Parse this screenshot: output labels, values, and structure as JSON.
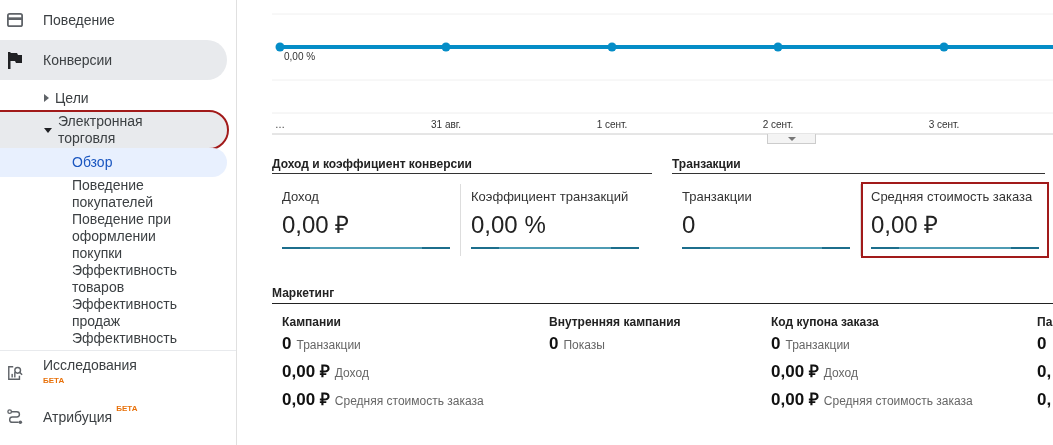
{
  "sidebar": {
    "items": [
      {
        "label": "Поведение",
        "selected": false
      },
      {
        "label": "Конверсии",
        "selected": true
      }
    ],
    "tree": [
      {
        "label": "Цели",
        "expanded": false,
        "highlighted": false
      },
      {
        "label": "Электронная торговля",
        "expanded": true,
        "highlighted": true,
        "children": [
          {
            "label": "Обзор",
            "selected": true
          },
          {
            "label": "Поведение покупателей",
            "selected": false
          },
          {
            "label": "Поведение при оформлении покупки",
            "selected": false
          },
          {
            "label": "Эффективность товаров",
            "selected": false
          },
          {
            "label": "Эффективность продаж",
            "selected": false
          },
          {
            "label": "Эффективность",
            "selected": false
          }
        ]
      }
    ],
    "bottom_items": [
      {
        "kind": "stacked",
        "label": "Исследования",
        "badge": "БЕТА"
      },
      {
        "kind": "inline",
        "label": "Атрибуция",
        "badge": "БЕТА"
      }
    ]
  },
  "chart": {
    "x_labels": [
      "…",
      "31 авг.",
      "1 сент.",
      "2 сент.",
      "3 сент."
    ],
    "point_label": "0,00 %"
  },
  "sections": [
    {
      "title": "Доход и коэффициент конверсии",
      "metrics": [
        {
          "label": "Доход",
          "value": "0,00 ₽",
          "highlighted": false
        },
        {
          "label": "Коэффициент транзакций",
          "value": "0,00 %",
          "highlighted": false
        }
      ]
    },
    {
      "title": "Транзакции",
      "metrics": [
        {
          "label": "Транзакции",
          "value": "0",
          "highlighted": false
        },
        {
          "label": "Средняя стоимость заказа",
          "value": "0,00 ₽",
          "highlighted": true
        }
      ]
    }
  ],
  "marketing": {
    "title": "Маркетинг",
    "columns": [
      {
        "title": "Кампании",
        "rows": [
          {
            "value": "0",
            "label": "Транзакции"
          },
          {
            "value": "0,00 ₽",
            "label": "Доход"
          },
          {
            "value": "0,00 ₽",
            "label": "Средняя стоимость заказа"
          }
        ]
      },
      {
        "title": "Внутренняя кампания",
        "rows": [
          {
            "value": "0",
            "label": "Показы"
          }
        ]
      },
      {
        "title": "Код купона заказа",
        "rows": [
          {
            "value": "0",
            "label": "Транзакции"
          },
          {
            "value": "0,00 ₽",
            "label": "Доход"
          },
          {
            "value": "0,00 ₽",
            "label": "Средняя стоимость заказа"
          }
        ]
      },
      {
        "title": "Па",
        "rows": [
          {
            "value": "0"
          },
          {
            "value": "0,"
          },
          {
            "value": "0,"
          }
        ]
      }
    ]
  }
}
